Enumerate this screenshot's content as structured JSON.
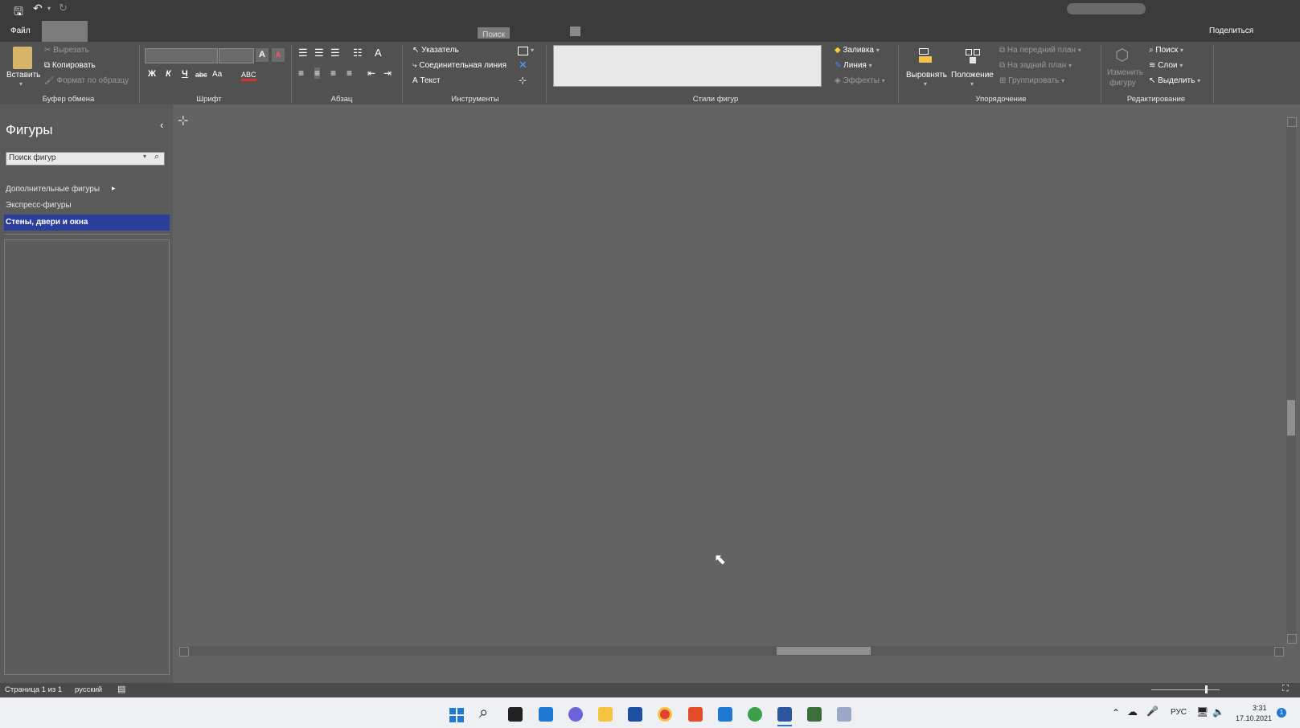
{
  "tabs": {
    "file": "Файл",
    "search": "Поиск",
    "share": "Поделиться"
  },
  "clipboard": {
    "paste": "Вставить",
    "cut": "Вырезать",
    "copy": "Копировать",
    "format_painter": "Формат по образцу",
    "label": "Буфер обмена"
  },
  "font": {
    "label": "Шрифт",
    "bold": "Ж",
    "italic": "К",
    "underline": "Ч",
    "strike": "abc",
    "case": "Aa",
    "font_color": "ABC",
    "grow": "A",
    "shrink": "A"
  },
  "paragraph": {
    "label": "Абзац"
  },
  "tools": {
    "label": "Инструменты",
    "pointer": "Указатель",
    "connector": "Соединительная линия",
    "text": "Текст"
  },
  "shape_styles": {
    "label": "Стили фигур",
    "fill": "Заливка",
    "line": "Линия",
    "effects": "Эффекты"
  },
  "arrange": {
    "label": "Упорядочение",
    "align": "Выровнять",
    "position": "Положение",
    "bring_front": "На передний план",
    "send_back": "На задний план",
    "group": "Группировать"
  },
  "editing": {
    "label": "Редактирование",
    "change_shape_1": "Изменить",
    "change_shape_2": "фигуру",
    "find": "Поиск",
    "layers": "Слои",
    "select": "Выделить"
  },
  "shapes_panel": {
    "title": "Фигуры",
    "search_placeholder": "Поиск фигур",
    "more_shapes": "Дополнительные фигуры",
    "quick_shapes": "Экспресс-фигуры",
    "walls": "Стены, двери и окна"
  },
  "status": {
    "page": "Страница 1 из 1",
    "language": "русский"
  },
  "tray": {
    "lang": "РУС",
    "time": "3:31",
    "date": "17.10.2021",
    "notif": "1"
  },
  "colors": {
    "accent": "#2b3e9c",
    "ribbon": "#515151",
    "canvas": "#636363",
    "taskbar": "#eef0f4"
  }
}
